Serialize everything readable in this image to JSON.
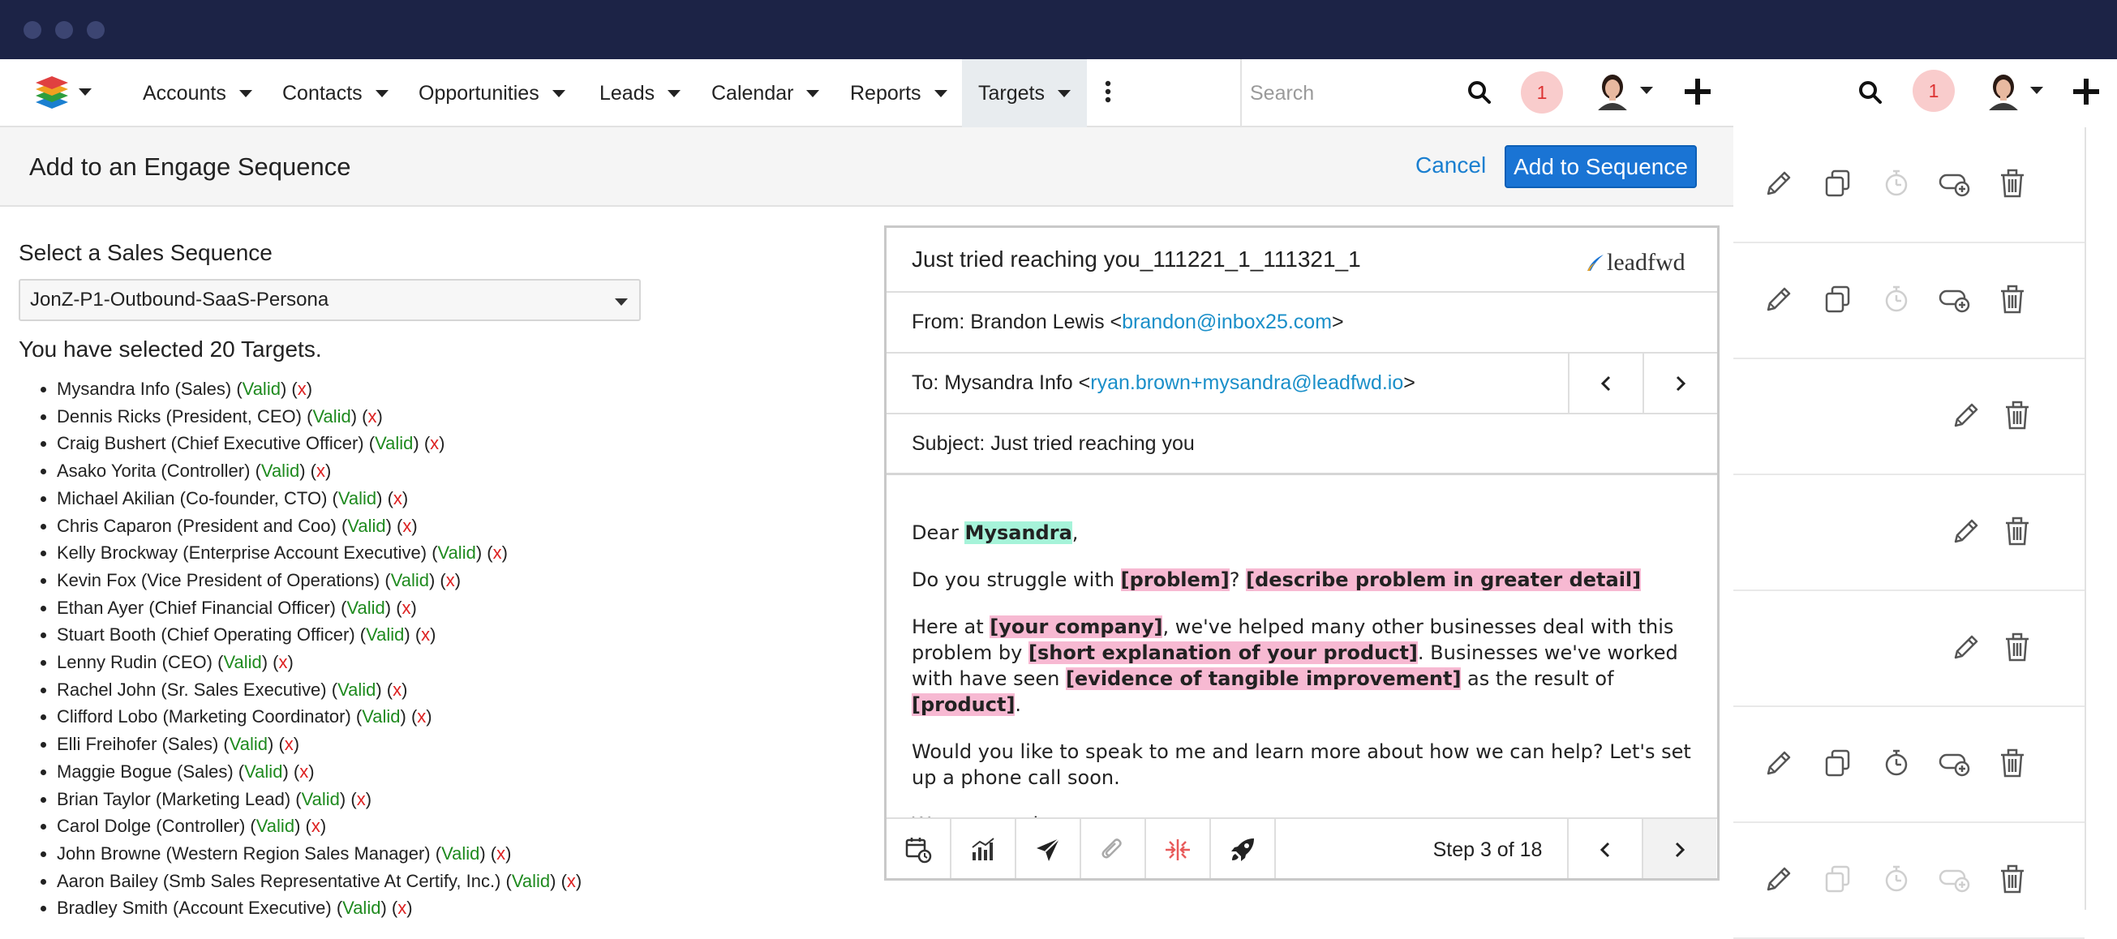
{
  "window": {
    "controls": [
      "close",
      "minimize",
      "maximize"
    ]
  },
  "nav": {
    "items": [
      {
        "label": "Accounts"
      },
      {
        "label": "Contacts"
      },
      {
        "label": "Opportunities"
      },
      {
        "label": "Leads"
      },
      {
        "label": "Calendar"
      },
      {
        "label": "Reports"
      },
      {
        "label": "Targets",
        "active": true
      }
    ],
    "search_placeholder": "Search",
    "notification_count": "1",
    "secondary_notification_count": "1"
  },
  "page": {
    "title": "Add to an Engage Sequence",
    "cancel_label": "Cancel",
    "add_label": "Add to Sequence"
  },
  "sequence": {
    "section_label": "Select a Sales Sequence",
    "selected": "JonZ-P1-Outbound-SaaS-Persona",
    "count_text": "You have selected 20 Targets."
  },
  "targets": [
    {
      "name": "Mysandra Info (Sales)",
      "status": "Valid"
    },
    {
      "name": "Dennis Ricks (President, CEO)",
      "status": "Valid"
    },
    {
      "name": "Craig Bushert (Chief Executive Officer)",
      "status": "Valid"
    },
    {
      "name": "Asako Yorita (Controller)",
      "status": "Valid"
    },
    {
      "name": "Michael Akilian (Co-founder, CTO)",
      "status": "Valid"
    },
    {
      "name": "Chris Caparon (President and Coo)",
      "status": "Valid"
    },
    {
      "name": "Kelly Brockway (Enterprise Account Executive)",
      "status": "Valid"
    },
    {
      "name": "Kevin Fox (Vice President of Operations)",
      "status": "Valid"
    },
    {
      "name": "Ethan Ayer (Chief Financial Officer)",
      "status": "Valid"
    },
    {
      "name": "Stuart Booth (Chief Operating Officer)",
      "status": "Valid"
    },
    {
      "name": "Lenny Rudin (CEO)",
      "status": "Valid"
    },
    {
      "name": "Rachel John (Sr. Sales Executive)",
      "status": "Valid"
    },
    {
      "name": "Clifford Lobo (Marketing Coordinator)",
      "status": "Valid"
    },
    {
      "name": "Elli Freihofer (Sales)",
      "status": "Valid"
    },
    {
      "name": "Maggie Bogue (Sales)",
      "status": "Valid"
    },
    {
      "name": "Brian Taylor (Marketing Lead)",
      "status": "Valid"
    },
    {
      "name": "Carol Dolge (Controller)",
      "status": "Valid"
    },
    {
      "name": "John Browne (Western Region Sales Manager)",
      "status": "Valid"
    },
    {
      "name": "Aaron Bailey (Smb Sales Representative At Certify, Inc.)",
      "status": "Valid"
    },
    {
      "name": "Bradley Smith (Account Executive)",
      "status": "Valid"
    }
  ],
  "remove_label": "x",
  "email": {
    "template_name": "Just tried reaching you_111221_1_111321_1",
    "brand": "leadfwd",
    "from_label": "From: Brandon Lewis <",
    "from_email": "brandon@inbox25.com",
    "to_label": "To: Mysandra Info <",
    "to_email": "ryan.brown+mysandra@leadfwd.io",
    "close_bracket": ">",
    "subject": "Subject: Just tried reaching you",
    "greeting_prefix": "Dear ",
    "greeting_name": "Mysandra",
    "greeting_suffix": ",",
    "p2_a": "Do you struggle with ",
    "p2_problem": "[problem]",
    "p2_b": "? ",
    "p2_detail": "[describe problem in greater detail]",
    "p3_a": "Here at ",
    "p3_company": "[your company]",
    "p3_b": ", we've helped many other businesses deal with this problem by ",
    "p3_explanation": "[short explanation of your product]",
    "p3_c": ". Businesses we've worked with have seen ",
    "p3_evidence": "[evidence of tangible improvement]",
    "p3_d": " as the result of ",
    "p3_product": "[product]",
    "p3_e": ".",
    "p4": "Would you like to speak to me and learn more about how we can help? Let's set up a phone call soon.",
    "closing": "Warm regards,",
    "step_text": "Step 3 of 18"
  },
  "step_actions": [
    {
      "icons": [
        "pencil-icon",
        "copy-icon",
        "timer-icon",
        "toggle-add-icon",
        "trash-icon"
      ],
      "disabled": [
        "timer-icon"
      ]
    },
    {
      "icons": [
        "pencil-icon",
        "copy-icon",
        "timer-icon",
        "toggle-add-icon",
        "trash-icon"
      ],
      "disabled": [
        "timer-icon"
      ]
    },
    {
      "icons": [
        "pencil-icon",
        "trash-icon"
      ]
    },
    {
      "icons": [
        "pencil-icon",
        "trash-icon"
      ]
    },
    {
      "icons": [
        "pencil-icon",
        "trash-icon"
      ]
    },
    {
      "icons": [
        "pencil-icon",
        "copy-icon",
        "timer-icon",
        "toggle-add-icon",
        "trash-icon"
      ]
    },
    {
      "icons": [
        "pencil-icon",
        "copy-icon",
        "timer-icon",
        "toggle-add-icon",
        "trash-icon"
      ],
      "disabled": [
        "copy-icon",
        "timer-icon",
        "toggle-add-icon"
      ]
    }
  ],
  "colors": {
    "titlebar": "#1c2346",
    "primary": "#1a74d4",
    "link": "#1a8fc9",
    "valid": "#1e8a1e",
    "remove": "#d22222",
    "highlight_name": "#a6f3d9",
    "highlight_placeholder": "#f7b9d2"
  }
}
